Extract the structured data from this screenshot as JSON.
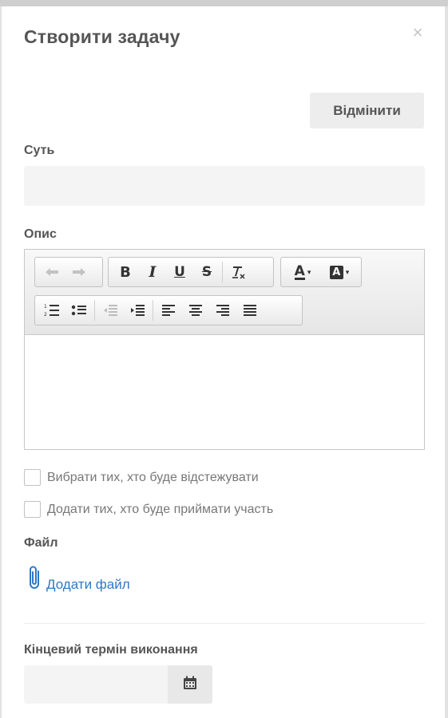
{
  "dialog": {
    "title": "Створити задачу",
    "close_symbol": "×",
    "cancel_label": "Відмінити"
  },
  "fields": {
    "summary_label": "Суть",
    "summary_value": "",
    "description_label": "Опис",
    "description_value": "",
    "file_label": "Файл",
    "add_file_label": "Додати файл",
    "deadline_label": "Кінцевий термін виконання",
    "deadline_value": ""
  },
  "checkboxes": {
    "watchers_label": "Вибрати тих, хто буде відстежувати",
    "watchers_checked": false,
    "participants_label": "Додати тих, хто буде приймати участь",
    "participants_checked": false
  },
  "toolbar": {
    "bold_glyph": "B",
    "italic_glyph": "I",
    "underline_glyph": "U",
    "strike_glyph": "S",
    "text_color_glyph": "A",
    "bg_color_glyph": "A",
    "icons": [
      "undo-icon",
      "redo-icon",
      "bold-icon",
      "italic-icon",
      "underline-icon",
      "strikethrough-icon",
      "clear-formatting-icon",
      "text-color-icon",
      "background-color-icon",
      "numbered-list-icon",
      "bulleted-list-icon",
      "outdent-icon",
      "indent-icon",
      "align-left-icon",
      "align-center-icon",
      "align-right-icon",
      "justify-icon"
    ]
  },
  "colors": {
    "link": "#2f78c4",
    "input_bg": "#f4f4f4",
    "button_bg": "#ededed"
  }
}
